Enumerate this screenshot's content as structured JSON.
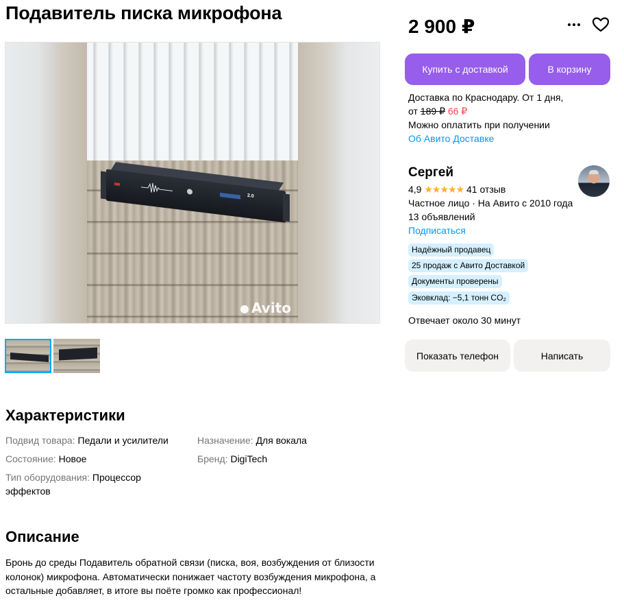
{
  "listing": {
    "title": "Подавитель писка микрофона",
    "price": "2 900 ₽"
  },
  "gallery": {
    "watermark": "Avito",
    "device_version_label": "2.0"
  },
  "actions": {
    "buy_with_delivery": "Купить с доставкой",
    "add_to_cart": "В корзину",
    "show_phone": "Показать телефон",
    "write": "Написать"
  },
  "delivery": {
    "line1": "Доставка по Краснодару. От 1 дня,",
    "from": "от",
    "old_price": "189 ₽",
    "new_price": "66 ₽",
    "payment": "Можно оплатить при получении",
    "about_link": "Об Авито Доставке"
  },
  "seller": {
    "name": "Сергей",
    "rating": "4,9",
    "stars": "★★★★★",
    "reviews": "41 отзыв",
    "type_since": "Частное лицо · На Авито с 2010 года",
    "ads_count": "13 объявлений",
    "subscribe": "Подписаться",
    "badges": [
      "Надёжный продавец",
      "25 продаж с Авито Доставкой",
      "Документы проверены",
      "Эковклад: −5,1 тонн CO₂"
    ],
    "response_time": "Отвечает около 30 минут"
  },
  "characteristics": {
    "heading": "Характеристики",
    "items": [
      {
        "key": "Подвид товара:",
        "value": "Педали и усилители"
      },
      {
        "key": "Назначение:",
        "value": "Для вокала"
      },
      {
        "key": "Состояние:",
        "value": "Новое"
      },
      {
        "key": "Бренд:",
        "value": "DigiTech"
      },
      {
        "key": "Тип оборудования:",
        "value": "Процессор"
      },
      {
        "key": "",
        "value": "эффектов"
      }
    ]
  },
  "description": {
    "heading": "Описание",
    "text": "Бронь до среды Подавитель обратной связи (писка, воя, возбуждения от близости колонок) микрофона. Автоматически понижает частоту возбуждения микрофона, а остальные добавляет, в итоге вы поёте громко как профессионал!"
  }
}
